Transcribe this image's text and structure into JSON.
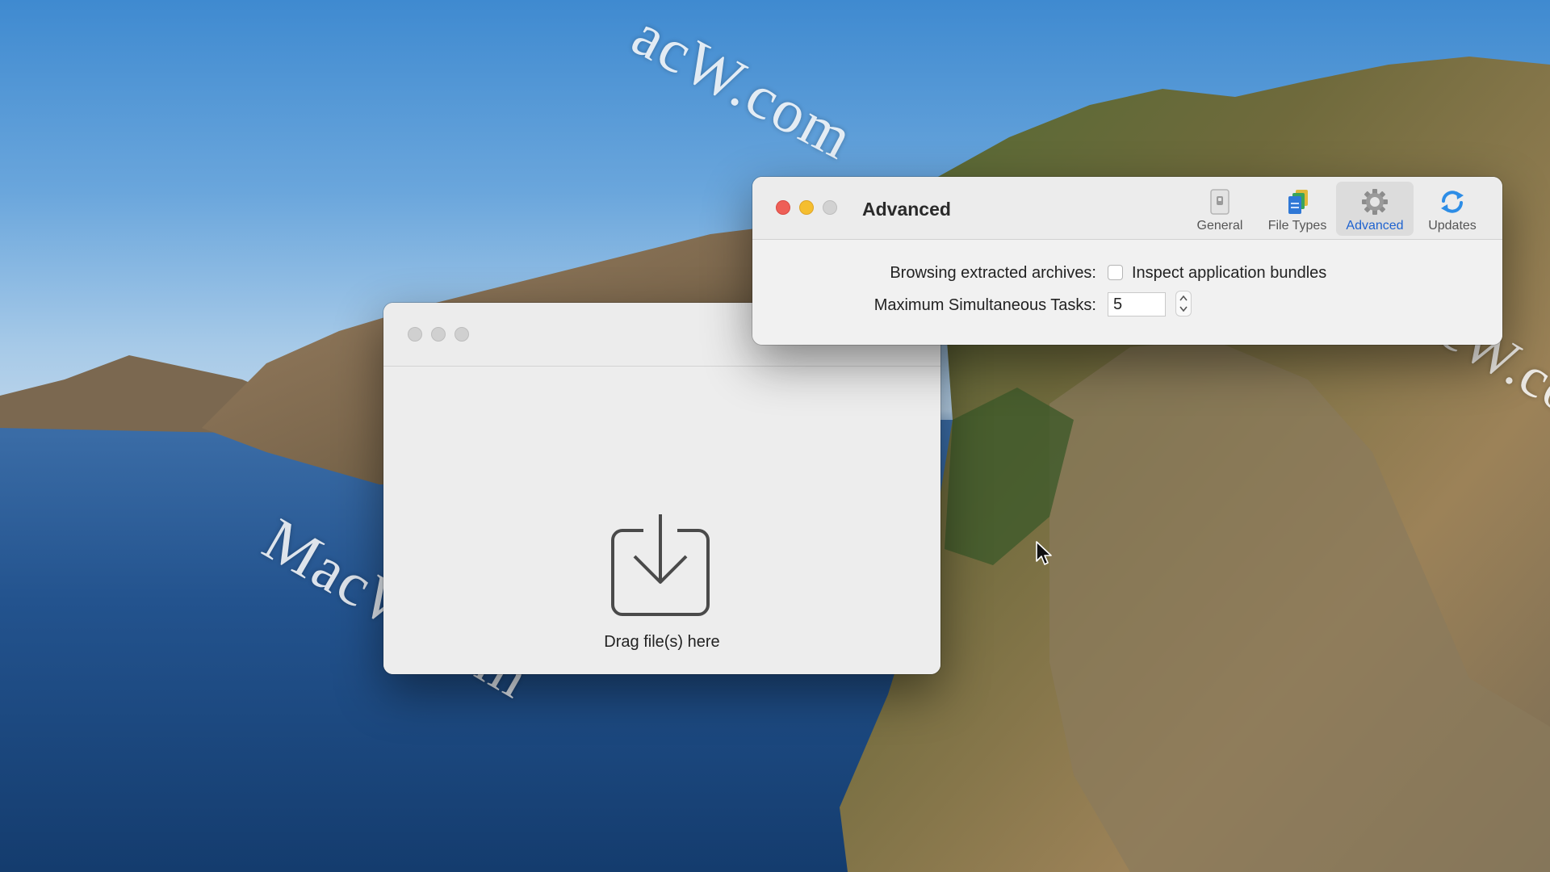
{
  "desktop": {
    "watermark_text": "MacW.com",
    "watermark_partial_top": "acW.com"
  },
  "drop_window": {
    "label": "Drag file(s) here",
    "icon": "download-tray-icon"
  },
  "prefs_window": {
    "title": "Advanced",
    "tabs": [
      {
        "label": "General",
        "icon": "switch-icon",
        "active": false
      },
      {
        "label": "File Types",
        "icon": "file-types-icon",
        "active": false
      },
      {
        "label": "Advanced",
        "icon": "gear-icon",
        "active": true
      },
      {
        "label": "Updates",
        "icon": "refresh-icon",
        "active": false
      }
    ],
    "browsing_label": "Browsing extracted archives:",
    "inspect_checkbox": {
      "label": "Inspect application bundles",
      "checked": false
    },
    "max_tasks_label": "Maximum Simultaneous Tasks:",
    "max_tasks_value": "5"
  },
  "colors": {
    "accent": "#1f63cf",
    "close": "#ee5f57",
    "minimize": "#f5be2f"
  }
}
